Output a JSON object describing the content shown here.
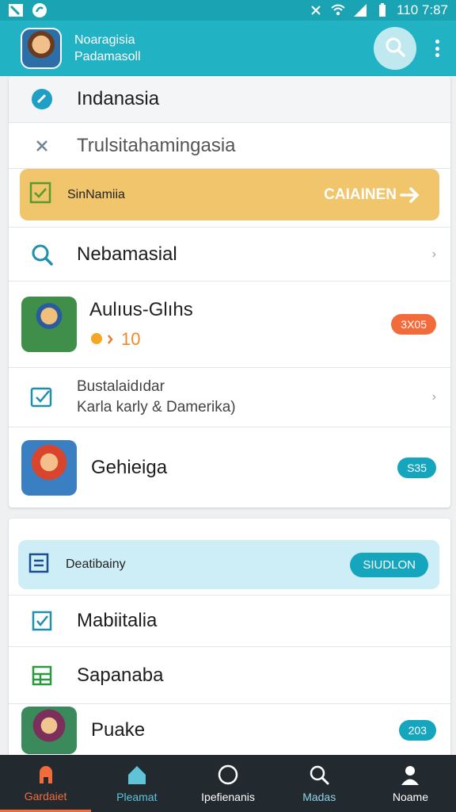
{
  "status_bar": {
    "time": "110 7:87"
  },
  "header": {
    "title": "Noaragisia",
    "subtitle": "Padamasoll"
  },
  "list1": {
    "row1": {
      "label": "Indanasia"
    },
    "row2": {
      "label": "Trulsitahamingasia"
    },
    "row3": {
      "label": "SinNamiia",
      "action": "CAIAINEN"
    },
    "row4": {
      "label": "Nebamasial"
    },
    "row5": {
      "title": "Aulıus-Glıhs",
      "rating": "10",
      "badge": "3X05"
    },
    "row6": {
      "line1": "Bustalaidıdar",
      "line2": "Karla karly & Damerika)"
    },
    "row7": {
      "label": "Gehieiga",
      "badge": "S35"
    }
  },
  "list2": {
    "row1": {
      "label": "Deatibainy",
      "action": "SIUDLON"
    },
    "row2": {
      "label": "Mabiitalia"
    },
    "row3": {
      "label": "Sapanaba"
    },
    "row4": {
      "label": "Puake",
      "badge": "203"
    }
  },
  "bottom_nav": [
    {
      "label": "Gardaiet",
      "icon": "game-icon"
    },
    {
      "label": "Pleamat",
      "icon": "home-icon"
    },
    {
      "label": "Ipefienanis",
      "icon": "circle-icon"
    },
    {
      "label": "Madas",
      "icon": "search-icon"
    },
    {
      "label": "Noame",
      "icon": "person-icon"
    }
  ],
  "colors": {
    "header": "#21b3c4",
    "accent_orange": "#f1c56c",
    "accent_blue": "#cdeef6",
    "badge_orange": "#f26b3a",
    "badge_teal": "#15a6be",
    "nav_bg": "#222a30"
  }
}
